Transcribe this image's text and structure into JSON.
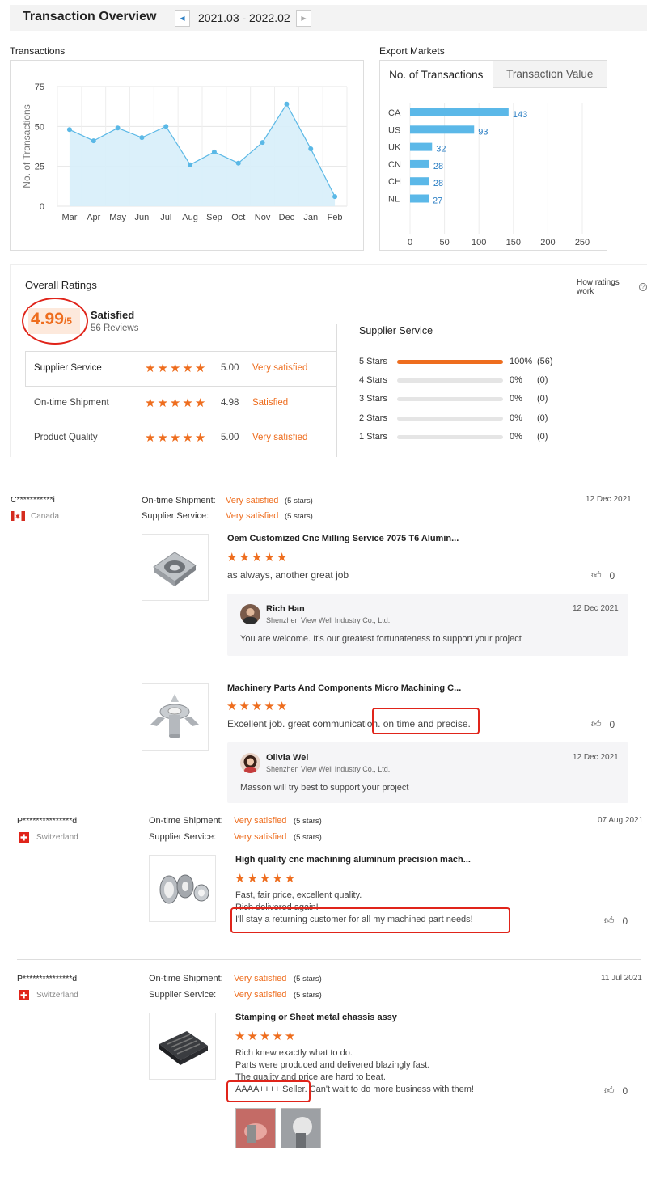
{
  "header": {
    "title": "Transaction Overview",
    "date_range": "2021.03 - 2022.02"
  },
  "transactions": {
    "label": "Transactions",
    "chart_data": {
      "type": "area",
      "categories": [
        "Mar",
        "Apr",
        "May",
        "Jun",
        "Jul",
        "Aug",
        "Sep",
        "Oct",
        "Nov",
        "Dec",
        "Jan",
        "Feb"
      ],
      "values": [
        48,
        41,
        49,
        43,
        50,
        26,
        34,
        27,
        40,
        64,
        36,
        6
      ],
      "ylabel": "No. of Transactions",
      "ylim": [
        0,
        75
      ],
      "yticks": [
        0,
        25,
        50,
        75
      ],
      "grid": true,
      "colors": {
        "line": "#5ab8e6",
        "fill": "#d7eefa"
      }
    }
  },
  "export_markets": {
    "label": "Export Markets",
    "tabs": [
      "No. of Transactions",
      "Transaction Value"
    ],
    "chart_data": {
      "type": "bar",
      "orientation": "horizontal",
      "categories": [
        "CA",
        "US",
        "UK",
        "CN",
        "CH",
        "NL"
      ],
      "values": [
        143,
        93,
        32,
        28,
        28,
        27
      ],
      "xlim": [
        0,
        250
      ],
      "xticks": [
        0,
        50,
        100,
        150,
        200,
        250
      ],
      "grid": true,
      "colors": {
        "bar": "#5bb8e8",
        "label": "#2c7fc4"
      }
    }
  },
  "ratings": {
    "title": "Overall Ratings",
    "how_link": "How ratings work",
    "score": "4.99",
    "score_suffix": "/5",
    "summary": "Satisfied",
    "reviews": "56 Reviews",
    "rows": [
      {
        "label": "Supplier Service",
        "value": "5.00",
        "verdict": "Very satisfied",
        "stars": 5
      },
      {
        "label": "On-time Shipment",
        "value": "4.98",
        "verdict": "Satisfied",
        "stars": 5
      },
      {
        "label": "Product Quality",
        "value": "5.00",
        "verdict": "Very satisfied",
        "stars": 5
      }
    ],
    "breakdown_title": "Supplier Service",
    "breakdown": [
      {
        "label": "5 Stars",
        "pct": "100%",
        "count": "(56)",
        "fraction": 1.0
      },
      {
        "label": "4 Stars",
        "pct": "0%",
        "count": "(0)",
        "fraction": 0
      },
      {
        "label": "3 Stars",
        "pct": "0%",
        "count": "(0)",
        "fraction": 0
      },
      {
        "label": "2 Stars",
        "pct": "0%",
        "count": "(0)",
        "fraction": 0
      },
      {
        "label": "1 Stars",
        "pct": "0%",
        "count": "(0)",
        "fraction": 0
      }
    ]
  },
  "reviews": [
    {
      "user": "C***********i",
      "country": "Canada",
      "date": "12 Dec 2021",
      "shipment_label": "On-time Shipment:",
      "shipment_value": "Very satisfied",
      "shipment_stars": "(5 stars)",
      "service_label": "Supplier Service:",
      "service_value": "Very satisfied",
      "service_stars": "(5 stars)",
      "items": [
        {
          "product": "Oem Customized Cnc Milling Service 7075 T6 Alumin...",
          "comment": "as always,  another great job",
          "likes": "0",
          "reply": {
            "name": "Rich Han",
            "company": "Shenzhen View Well Industry Co., Ltd.",
            "date": "12 Dec 2021",
            "text": "You are welcome. It's our greatest fortunateness to support your project"
          }
        },
        {
          "product": "Machinery Parts And Components Micro Machining C...",
          "comment": "Excellent job. great communication. on time and precise.",
          "likes": "0",
          "reply": {
            "name": "Olivia Wei",
            "company": "Shenzhen View Well Industry Co., Ltd.",
            "date": "12 Dec 2021",
            "text": "Masson will try  best to support your project"
          }
        }
      ]
    },
    {
      "user": "P***************d",
      "country": "Switzerland",
      "date": "07 Aug 2021",
      "shipment_label": "On-time Shipment:",
      "shipment_value": "Very satisfied",
      "shipment_stars": "(5 stars)",
      "service_label": "Supplier Service:",
      "service_value": "Very satisfied",
      "service_stars": "(5 stars)",
      "product": "High quality cnc machining aluminum precision mach...",
      "lines": [
        "Fast, fair price, excellent quality.",
        "Rich delivered again!",
        "I'll stay a returning customer for all my machined part needs!"
      ],
      "likes": "0"
    },
    {
      "user": "P***************d",
      "country": "Switzerland",
      "date": "11 Jul 2021",
      "shipment_label": "On-time Shipment:",
      "shipment_value": "Very satisfied",
      "shipment_stars": "(5 stars)",
      "service_label": "Supplier Service:",
      "service_value": "Very satisfied",
      "service_stars": "(5 stars)",
      "product": "Stamping or Sheet metal chassis assy",
      "lines": [
        "Rich knew exactly what to do.",
        "Parts were produced and delivered blazingly fast.",
        "The quality and price are hard to beat.",
        "AAAA++++ Seller. Can't wait to do more business with them!"
      ],
      "likes": "0"
    }
  ]
}
